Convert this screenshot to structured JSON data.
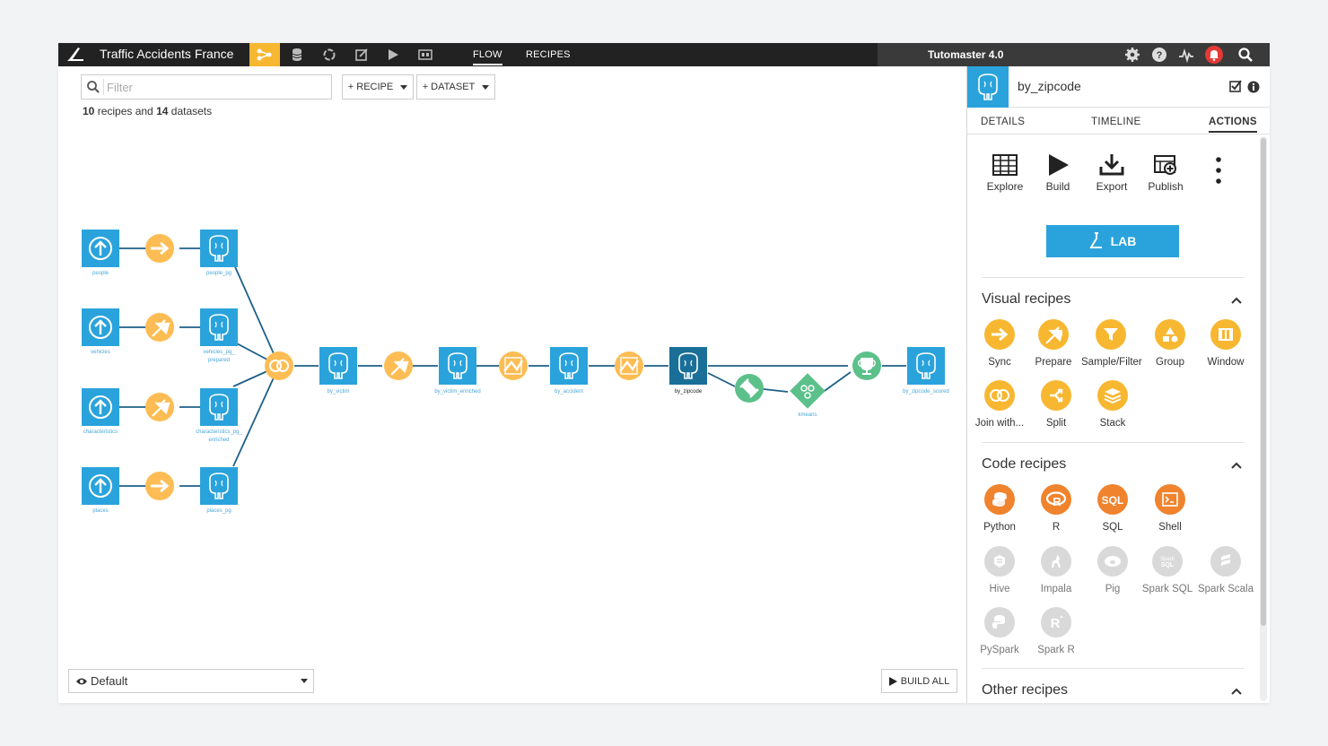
{
  "topbar": {
    "project_name": "Traffic Accidents France",
    "nav_links": [
      "FLOW",
      "RECIPES"
    ],
    "instance_name": "Tutomaster 4.0",
    "icons": [
      "bird-logo-icon",
      "flow-icon",
      "datasets-icon",
      "models-icon",
      "notebooks-icon",
      "run-icon",
      "dashboard-icon",
      "gear-icon",
      "help-icon",
      "activity-icon",
      "bell-icon",
      "search-icon"
    ]
  },
  "toolbar": {
    "filter_placeholder": "Filter",
    "recipe_button": "+ RECIPE",
    "dataset_button": "+ DATASET",
    "counts": {
      "recipes": "10",
      "recipes_text": " recipes and ",
      "datasets": "14",
      "datasets_text": " datasets"
    }
  },
  "flow": {
    "datasets": {
      "people": "people",
      "people_pg": "people_pg",
      "vehicles": "vehicles",
      "vehicles_pg_1": "vehicles_pg_",
      "vehicles_pg_2": "prepared",
      "characteristics": "characteristics",
      "characteristics_pg_1": "characteristics_pg_",
      "characteristics_pg_2": "enriched",
      "places": "places",
      "places_pg": "places_pg",
      "by_victim": "by_victim",
      "by_victim_enriched": "by_victim_enriched",
      "by_accident": "by_accident",
      "by_zipcode": "by_zipcode",
      "kmeans": "kmeans",
      "by_zipcode_scored": "by_zipcode_scored"
    }
  },
  "bottom": {
    "view_label": "Default",
    "build_all_label": "BUILD ALL"
  },
  "panel": {
    "dataset_name": "by_zipcode",
    "tabs": [
      "DETAILS",
      "TIMELINE",
      "ACTIONS"
    ],
    "active_tab": "ACTIONS",
    "actions": [
      "Explore",
      "Build",
      "Export",
      "Publish"
    ],
    "lab_label": "LAB",
    "sections": {
      "visual": {
        "title": "Visual recipes",
        "items": [
          "Sync",
          "Prepare",
          "Sample/Filter",
          "Group",
          "Window",
          "Join with...",
          "Split",
          "Stack"
        ]
      },
      "code": {
        "title": "Code recipes",
        "items": [
          "Python",
          "R",
          "SQL",
          "Shell",
          "Hive",
          "Impala",
          "Pig",
          "Spark SQL",
          "Spark Scala",
          "PySpark",
          "Spark R"
        ]
      },
      "other": {
        "title": "Other recipes"
      }
    },
    "colors": {
      "visual": "#f7b731",
      "code": "#f0832d",
      "disabled": "#d9d9d9",
      "dataset": "#2aa3dc",
      "ml": "#5cc08a"
    }
  }
}
